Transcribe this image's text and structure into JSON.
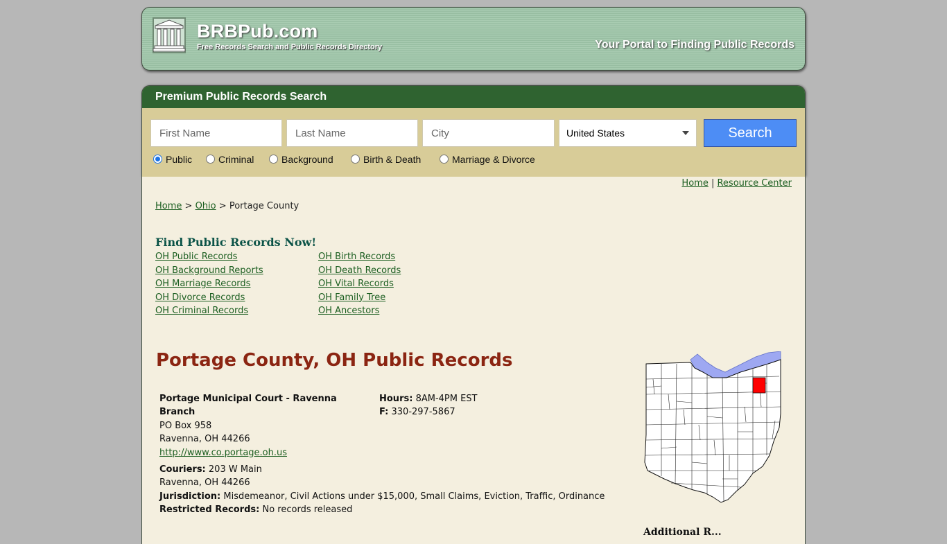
{
  "header": {
    "site_name": "BRBPub.com",
    "site_subtitle": "Free Records Search and Public Records Directory",
    "tagline": "Your Portal to Finding Public Records"
  },
  "search": {
    "title": "Premium Public Records Search",
    "first_name_placeholder": "First Name",
    "last_name_placeholder": "Last Name",
    "city_placeholder": "City",
    "country_selected": "United States",
    "button_label": "Search",
    "record_types": [
      {
        "label": "Public",
        "selected": true
      },
      {
        "label": "Criminal",
        "selected": false
      },
      {
        "label": "Background",
        "selected": false
      },
      {
        "label": "Birth & Death",
        "selected": false
      },
      {
        "label": "Marriage & Divorce",
        "selected": false
      }
    ]
  },
  "top_nav": {
    "home": "Home",
    "separator": "|",
    "resource_center": "Resource Center"
  },
  "breadcrumb": {
    "home": "Home",
    "sep": ">",
    "state": "Ohio",
    "current": "Portage County"
  },
  "find_records": {
    "title": "Find Public Records Now!",
    "left_links": [
      "OH Public Records",
      "OH Background Reports",
      "OH Marriage Records",
      "OH Divorce Records",
      "OH Criminal Records"
    ],
    "right_links": [
      "OH Birth Records",
      "OH Death Records",
      "OH Vital Records",
      "OH Family Tree",
      "OH Ancestors"
    ]
  },
  "county": {
    "title": "Portage County, OH Public Records"
  },
  "office": {
    "name": "Portage Municipal Court - Ravenna Branch",
    "address1": "PO Box 958",
    "address2": "Ravenna, OH 44266",
    "website": "http://www.co.portage.oh.us",
    "hours_label": "Hours:",
    "hours_value": "8AM-4PM EST",
    "fax_label": "F:",
    "fax_value": "330-297-5867",
    "couriers_label": "Couriers:",
    "couriers_address1": "203 W Main",
    "couriers_address2": "Ravenna, OH 44266",
    "jurisdiction_label": "Jurisdiction:",
    "jurisdiction_value": "Misdemeanor, Civil Actions under $15,000, Small Claims, Eviction, Traffic, Ordinance",
    "restricted_label": "Restricted Records:",
    "restricted_value": "No records released"
  },
  "sidebar": {
    "additional_heading": "Additional R..."
  },
  "colors": {
    "header_green": "#a9ccb2",
    "bar_green": "#2f6330",
    "search_bg": "#d8cc98",
    "content_bg": "#f4efdf",
    "title_red": "#8b2512",
    "button_blue": "#4d8df5",
    "highlight_county": "#ff0000",
    "lake_blue": "#9ea8f2"
  }
}
